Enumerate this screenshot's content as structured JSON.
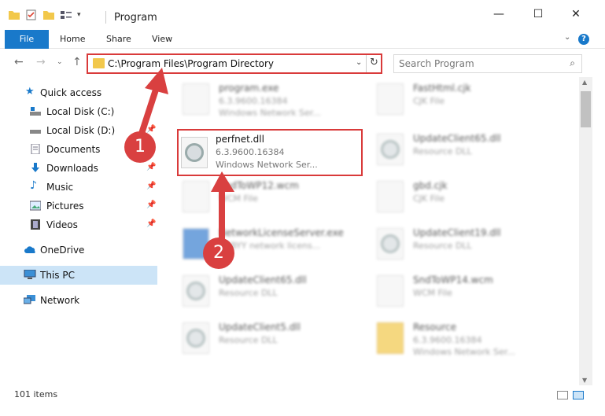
{
  "window": {
    "title": "Program",
    "minimize": "—",
    "maximize": "☐",
    "close": "✕"
  },
  "ribbon": {
    "file": "File",
    "home": "Home",
    "share": "Share",
    "view": "View",
    "help": "?"
  },
  "address": {
    "path": "C:\\Program Files\\Program Directory",
    "search_placeholder": "Search Program"
  },
  "sidebar": {
    "quick_access": "Quick access",
    "local_c": "Local Disk (C:)",
    "local_d": "Local Disk (D:)",
    "documents": "Documents",
    "downloads": "Downloads",
    "music": "Music",
    "pictures": "Pictures",
    "videos": "Videos",
    "onedrive": "OneDrive",
    "thispc": "This PC",
    "network": "Network"
  },
  "files": [
    {
      "name": "program.exe",
      "line1": "6.3.9600.16384",
      "line2": "Windows Network Ser..."
    },
    {
      "name": "FastHtml.cjk",
      "line1": "CJK File",
      "line2": ""
    },
    {
      "name": "perfnet.dll",
      "line1": "6.3.9600.16384",
      "line2": "Windows Network Ser..."
    },
    {
      "name": "UpdateClient65.dll",
      "line1": "Resource DLL",
      "line2": ""
    },
    {
      "name": "SndToWP12.wcm",
      "line1": "WCM File",
      "line2": ""
    },
    {
      "name": "gbd.cjk",
      "line1": "CJK File",
      "line2": ""
    },
    {
      "name": "NetworkLicenseServer.exe",
      "line1": "ABBYY network licens...",
      "line2": ""
    },
    {
      "name": "UpdateClient19.dll",
      "line1": "Resource DLL",
      "line2": ""
    },
    {
      "name": "UpdateClient65.dll",
      "line1": "Resource DLL",
      "line2": ""
    },
    {
      "name": "SndToWP14.wcm",
      "line1": "WCM File",
      "line2": ""
    },
    {
      "name": "UpdateClient5.dll",
      "line1": "Resource DLL",
      "line2": ""
    },
    {
      "name": "Resource",
      "line1": "6.3.9600.16384",
      "line2": "Windows Network Ser..."
    }
  ],
  "status": {
    "count": "101 items"
  },
  "annotations": {
    "step1": "1",
    "step2": "2"
  },
  "colors": {
    "accent": "#1979ca",
    "highlight": "#d93a3a"
  }
}
